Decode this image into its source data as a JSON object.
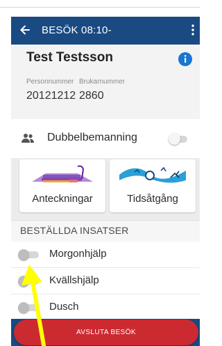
{
  "appbar": {
    "title": "BESÖK 08:10-"
  },
  "person": {
    "name": "Test Testsson",
    "personnummer_label": "Personnummer",
    "personnummer": "20121212",
    "brukarnummer_label": "Brukarnummer",
    "brukarnummer": "2860"
  },
  "double_staffing": {
    "label": "Dubbelbemanning",
    "enabled": false
  },
  "tiles": [
    {
      "label": "Anteckningar",
      "icon": "notes-illustration-icon"
    },
    {
      "label": "Tidsåtgång",
      "icon": "time-illustration-icon"
    }
  ],
  "ordered_section": {
    "title": "BESTÄLLDA INSATSER",
    "items": [
      {
        "label": "Morgonhjälp",
        "done": false
      },
      {
        "label": "Kvällshjälp",
        "done": false
      },
      {
        "label": "Dusch",
        "done": false
      }
    ]
  },
  "end_visit_button": {
    "label": "AVSLUTA BESÖK"
  },
  "colors": {
    "appbar": "#1a4a82",
    "end_button": "#cc2a31",
    "annotation_arrow": "#ffff00",
    "info_icon": "#1976d2"
  }
}
